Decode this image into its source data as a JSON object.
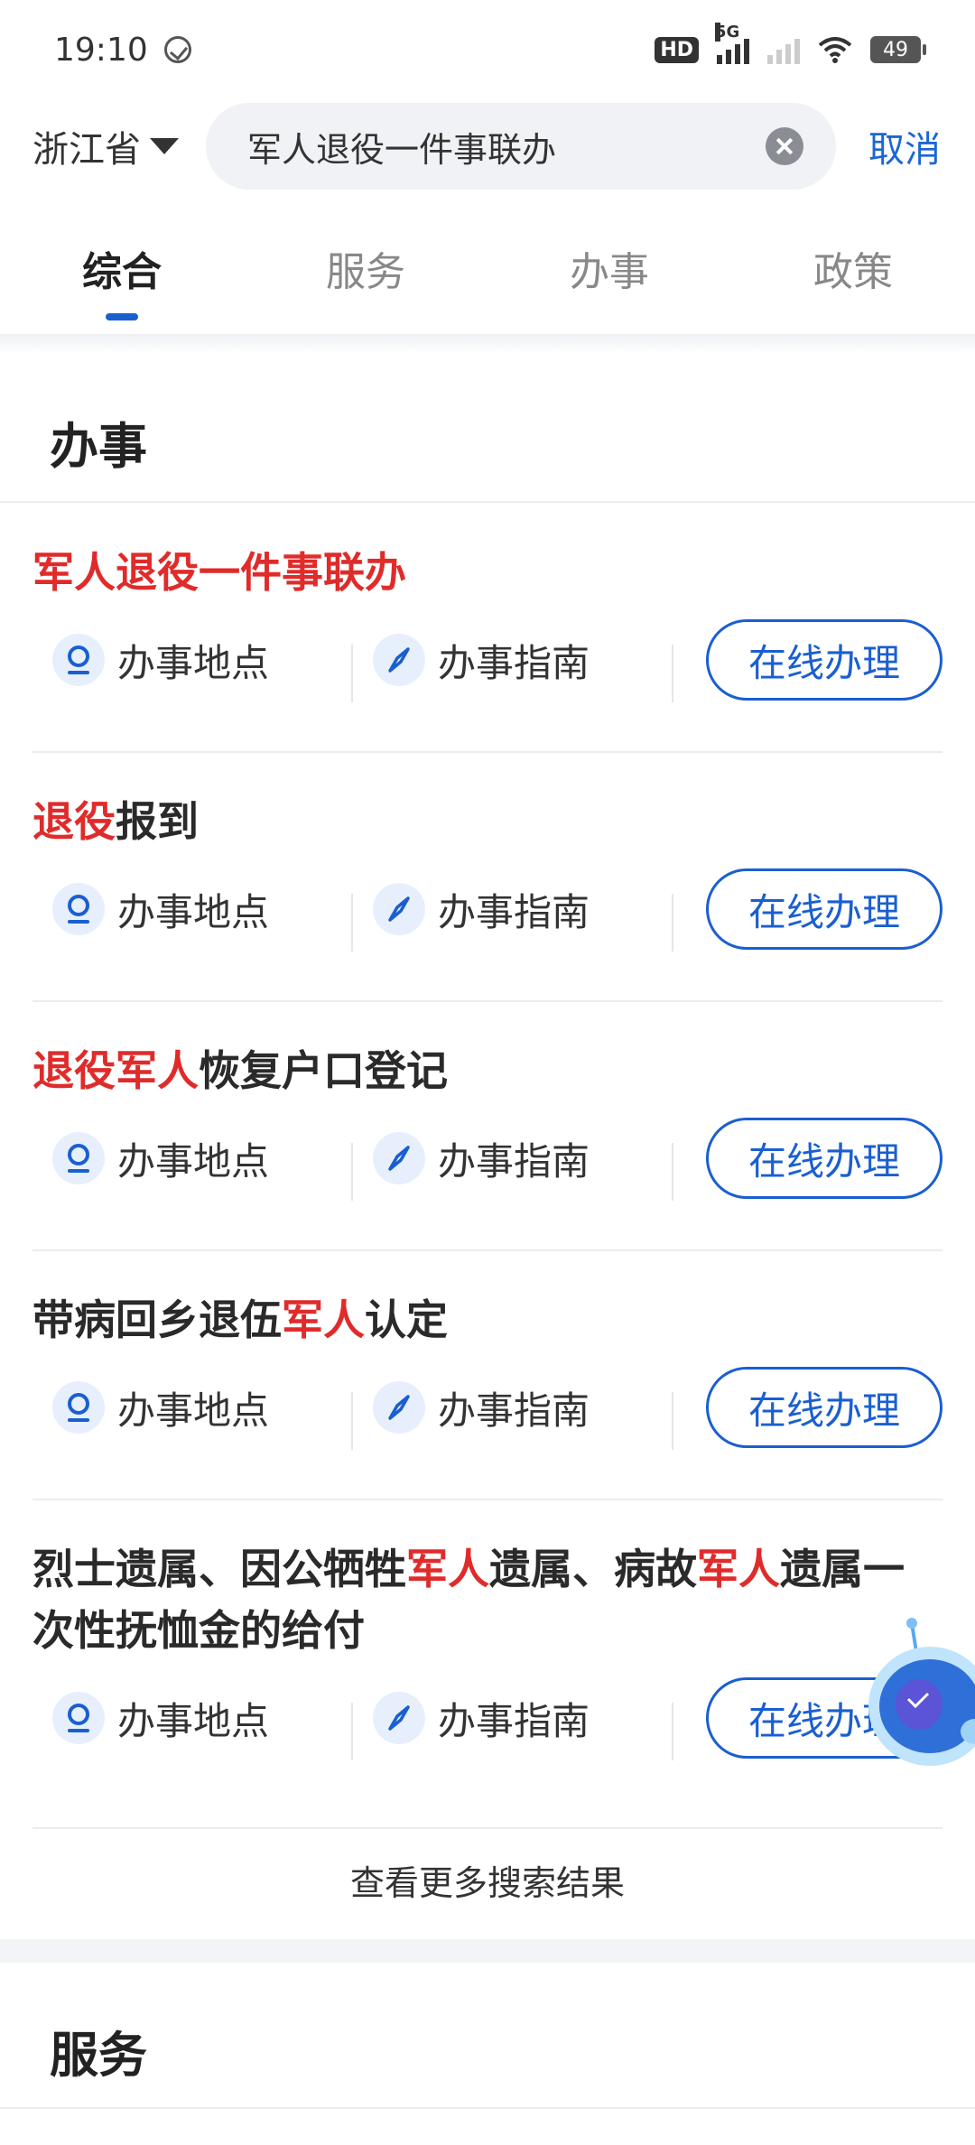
{
  "status": {
    "time": "19:10",
    "hd": "HD",
    "net": "5G",
    "battery": "49"
  },
  "search": {
    "province": "浙江省",
    "query": "军人退役一件事联办",
    "cancel": "取消"
  },
  "tabs": [
    {
      "label": "综合",
      "active": true
    },
    {
      "label": "服务",
      "active": false
    },
    {
      "label": "办事",
      "active": false
    },
    {
      "label": "政策",
      "active": false
    }
  ],
  "section_banshi": "办事",
  "actions": {
    "location": "办事地点",
    "guide": "办事指南",
    "online": "在线办理"
  },
  "items": [
    {
      "title_parts": [
        {
          "t": "军人退役一件事联办",
          "hl": true
        }
      ]
    },
    {
      "title_parts": [
        {
          "t": "退役",
          "hl": true
        },
        {
          "t": "报到",
          "hl": false
        }
      ]
    },
    {
      "title_parts": [
        {
          "t": "退役军人",
          "hl": true
        },
        {
          "t": "恢复户口登记",
          "hl": false
        }
      ]
    },
    {
      "title_parts": [
        {
          "t": "带病回乡退伍",
          "hl": false
        },
        {
          "t": "军人",
          "hl": true
        },
        {
          "t": "认定",
          "hl": false
        }
      ]
    },
    {
      "title_parts": [
        {
          "t": "烈士遗属、因公牺牲",
          "hl": false
        },
        {
          "t": "军人",
          "hl": true
        },
        {
          "t": "遗属、病故",
          "hl": false
        },
        {
          "t": "军人",
          "hl": true
        },
        {
          "t": "遗属一次性抚恤金的给付",
          "hl": false
        }
      ]
    }
  ],
  "more": "查看更多搜索结果",
  "section_fuwu": "服务",
  "colors": {
    "accent": "#1a5fd0",
    "highlight": "#e02b2b"
  }
}
